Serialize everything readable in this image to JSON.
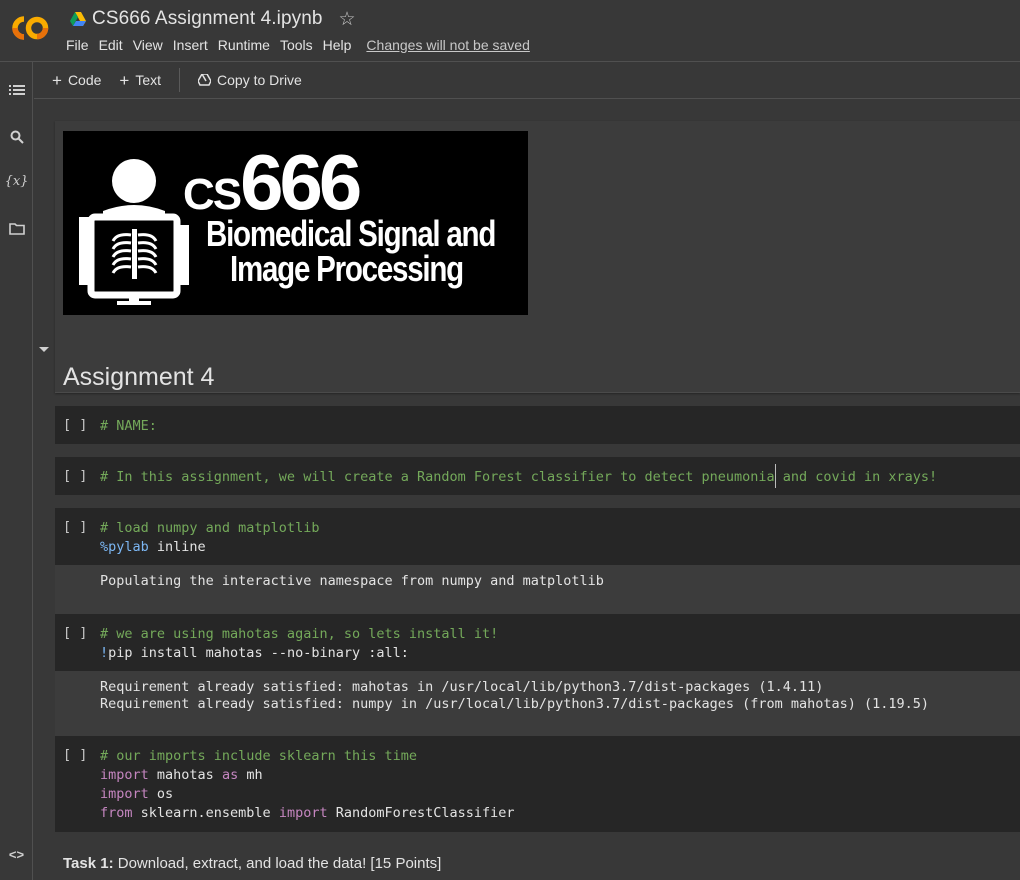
{
  "app": {
    "title": "CS666 Assignment 4.ipynb",
    "menu": [
      "File",
      "Edit",
      "View",
      "Insert",
      "Runtime",
      "Tools",
      "Help"
    ],
    "unsaved_notice": "Changes will not be saved",
    "brand_colors": {
      "logo_orange": "#f9ab00",
      "logo_dark": "#e8710a"
    }
  },
  "toolbar": {
    "code_label": "Code",
    "text_label": "Text",
    "copy_label": "Copy to Drive"
  },
  "rail": {
    "icons": [
      "table-of-contents-icon",
      "search-icon",
      "variables-icon",
      "folder-icon",
      "code-snippets-icon"
    ],
    "variables_glyph": "{x}",
    "snippets_glyph": "<>"
  },
  "banner": {
    "cs": "CS",
    "number": "666",
    "line1": "Biomedical Signal and",
    "line2": "Image Processing"
  },
  "heading": "Assignment 4",
  "cells": {
    "bracket": "[ ]",
    "c1": {
      "line1": "# NAME:"
    },
    "c2": {
      "line1": "# In this assignment, we will create a Random Forest classifier to detect pneumonia and covid in xrays!"
    },
    "c3": {
      "line1": "# load numpy and matplotlib",
      "magic": "%pylab",
      "rest": " inline",
      "output": "Populating the interactive namespace from numpy and matplotlib"
    },
    "c4": {
      "line1": "# we are using mahotas again, so lets install it!",
      "bang": "!",
      "rest": "pip install mahotas --no-binary :all:",
      "output": "Requirement already satisfied: mahotas in /usr/local/lib/python3.7/dist-packages (1.4.11)\nRequirement already satisfied: numpy in /usr/local/lib/python3.7/dist-packages (from mahotas) (1.19.5)"
    },
    "c5": {
      "line1": "# our imports include sklearn this time",
      "l2_kw": "import",
      "l2_a": " mahotas ",
      "l2_kw2": "as",
      "l2_b": " mh",
      "l3_kw": "import",
      "l3_a": " os",
      "l4_kw": "from",
      "l4_a": " sklearn.ensemble ",
      "l4_kw2": "import",
      "l4_b": " RandomForestClassifier"
    }
  },
  "task": {
    "bold": "Task 1:",
    "rest": " Download, extract, and load the data! [15 Points]"
  }
}
